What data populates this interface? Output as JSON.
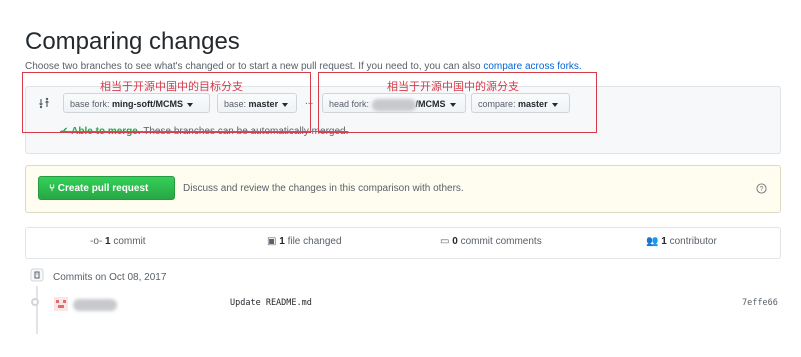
{
  "header": {
    "title": "Comparing changes",
    "subtitle": "Choose two branches to see what's changed or to start a new pull request. If you need to, you can also",
    "subtitle_link": "compare across forks."
  },
  "range": {
    "base_fork_prefix": "base fork:",
    "base_fork_value": "ming-soft/MCMS",
    "base_prefix": "base:",
    "base_value": "master",
    "separator": "...",
    "head_fork_prefix": "head fork:",
    "head_fork_value": "/MCMS",
    "compare_prefix": "compare:",
    "compare_value": "master",
    "merge_status": "Able to merge.",
    "merge_detail": "These branches can be automatically merged."
  },
  "annotations": {
    "left": "相当于开源中国中的目标分支",
    "right": "相当于开源中国中的源分支"
  },
  "pull_request": {
    "button_label": "Create pull request",
    "description": "Discuss and review the changes in this comparison with others.",
    "help_icon": "question-icon"
  },
  "stats": {
    "commits_count": "1",
    "commits_label": "commit",
    "files_count": "1",
    "files_label": "file changed",
    "comments_count": "0",
    "comments_label": "commit comments",
    "contributors_count": "1",
    "contributors_label": "contributor"
  },
  "commits": {
    "heading": "Commits on Oct 08, 2017",
    "items": [
      {
        "message": "Update README.md",
        "sha": "7effe66"
      }
    ]
  },
  "colors": {
    "accent_green": "#28a745",
    "link_blue": "#0366d6",
    "annotation_red": "#d73a49"
  }
}
